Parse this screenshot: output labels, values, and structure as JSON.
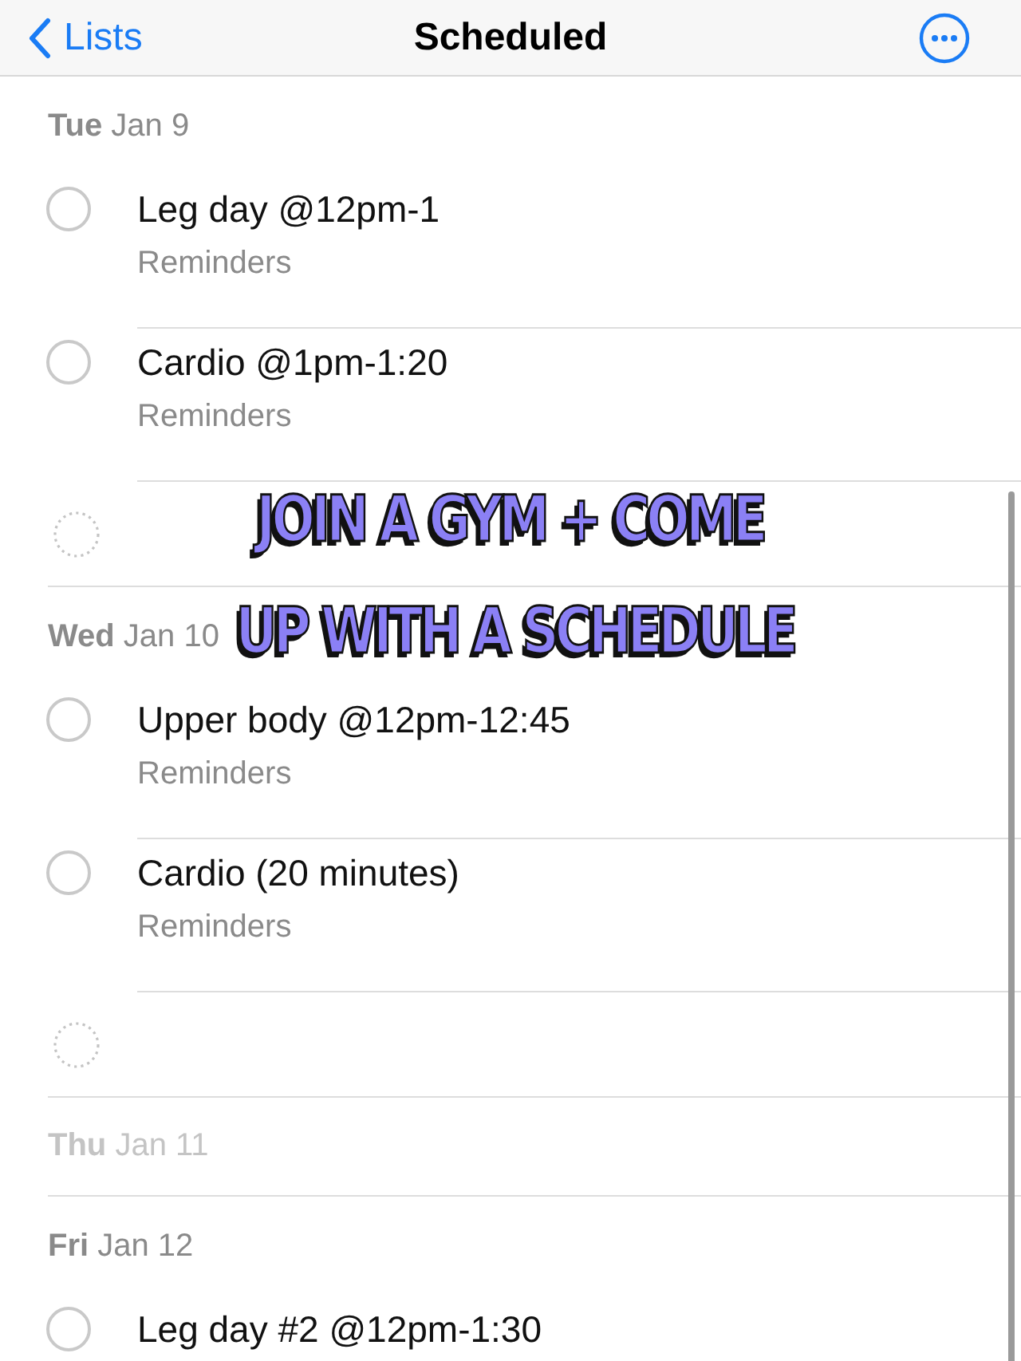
{
  "nav": {
    "back": "Lists",
    "title": "Scheduled"
  },
  "days": [
    {
      "day": "Tue",
      "date": "Jan 9",
      "empty": false,
      "items": [
        {
          "kind": "reminder",
          "title": "Leg day @12pm-1",
          "list": "Reminders",
          "completed": false
        },
        {
          "kind": "reminder",
          "title": "Cardio @1pm-1:20",
          "list": "Reminders",
          "completed": false
        },
        {
          "kind": "new"
        }
      ]
    },
    {
      "day": "Wed",
      "date": "Jan 10",
      "empty": false,
      "items": [
        {
          "kind": "reminder",
          "title": "Upper body @12pm-12:45",
          "list": "Reminders",
          "completed": false
        },
        {
          "kind": "reminder",
          "title": "Cardio (20 minutes)",
          "list": "Reminders",
          "completed": false
        },
        {
          "kind": "new"
        }
      ]
    },
    {
      "day": "Thu",
      "date": "Jan 11",
      "empty": true
    },
    {
      "day": "Fri",
      "date": "Jan 12",
      "empty": false,
      "items": [
        {
          "kind": "reminder",
          "title": "Leg day #2 @12pm-1:30",
          "completed": false
        }
      ]
    }
  ],
  "caption": [
    "JOIN A GYM + COME",
    "UP WITH A SCHEDULE"
  ]
}
